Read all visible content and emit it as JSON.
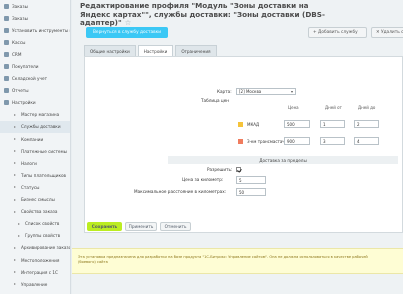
{
  "sidebar": {
    "items": [
      {
        "label": "Заказы",
        "kind": "top"
      },
      {
        "label": "Заказы",
        "kind": "top"
      },
      {
        "label": "Установить инструменты и",
        "kind": "top"
      },
      {
        "label": "Кассы",
        "kind": "top"
      },
      {
        "label": "CRM",
        "kind": "top"
      },
      {
        "label": "Покупатели",
        "kind": "top"
      },
      {
        "label": "Складской учет",
        "kind": "top"
      },
      {
        "label": "Отчеты",
        "kind": "top"
      },
      {
        "label": "Настройки",
        "kind": "top-open"
      },
      {
        "label": "Мастер магазина",
        "kind": "sub"
      },
      {
        "label": "Службы доставки",
        "kind": "sub-hl"
      },
      {
        "label": "Компании",
        "kind": "sub"
      },
      {
        "label": "Платежные системы",
        "kind": "sub"
      },
      {
        "label": "Налоги",
        "kind": "sub"
      },
      {
        "label": "Типы плательщиков",
        "kind": "sub"
      },
      {
        "label": "Статусы",
        "kind": "sub"
      },
      {
        "label": "Бизнес смыслы",
        "kind": "sub"
      },
      {
        "label": "Свойства заказа",
        "kind": "sub"
      },
      {
        "label": "Список свойств",
        "kind": "sub2"
      },
      {
        "label": "Группы свойств",
        "kind": "sub2"
      },
      {
        "label": "Архивирование заказов",
        "kind": "sub"
      },
      {
        "label": "Местоположения",
        "kind": "sub"
      },
      {
        "label": "Интеграция с 1С",
        "kind": "sub"
      },
      {
        "label": "Управление",
        "kind": "sub"
      }
    ]
  },
  "header": {
    "title": "Редактирование профиля \"Модуль \"Зоны доставки на Яндекс картах\"\", службы доставки: \"Зоны доставки (DBS-адаптер)\"",
    "star": "☆"
  },
  "toolbar": {
    "back_label": "Вернуться в службу доставки",
    "add_label": "+ Добавить службу",
    "delete_label": "✕ Удалить с"
  },
  "tabs": [
    {
      "label": "Общие настройки",
      "active": false
    },
    {
      "label": "Настройки",
      "active": true
    },
    {
      "label": "Ограничения",
      "active": false
    }
  ],
  "form": {
    "map_label": "Карта:",
    "map_value": "[2] Москва",
    "prices_label": "Таблица цен",
    "col_price": "Цена",
    "col_days_from": "Дней от",
    "col_days_to": "Дней до",
    "zones": [
      {
        "name": "МКАД",
        "color": "#f5c33a",
        "price": "500",
        "from": "1",
        "to": "2"
      },
      {
        "name": "З-км трансмастачек",
        "color": "#f07c5e",
        "price": "900",
        "from": "3",
        "to": "4"
      }
    ],
    "section_label": "Доставка за пределы",
    "allow_label": "Разрешить:",
    "allow_checked": true,
    "per_km_label": "Цена за километр:",
    "per_km_value": "5",
    "max_dist_label": "Максимальное расстояние в километрах:",
    "max_dist_value": "50"
  },
  "actions": {
    "save_label": "Сохранить",
    "apply_label": "Применить",
    "cancel_label": "Отменить"
  },
  "notice": {
    "line1": "Эта установка предназначена для разработки на базе продукта \"1С-Битрикс: Управление сайтом\". Она не должна использоваться в качестве рабочей",
    "line2": "(боевого) сайта"
  }
}
